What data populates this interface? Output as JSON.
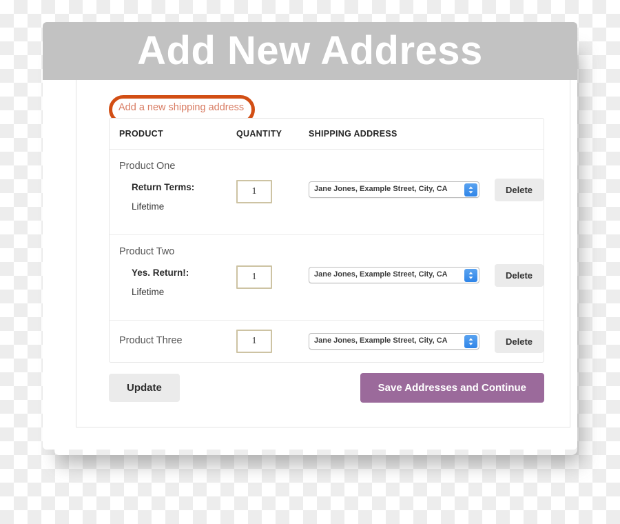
{
  "window": {
    "title": "Add New Address"
  },
  "annotation": {
    "link_label": "Add a new shipping address",
    "highlight_color": "#d24e14",
    "link_color": "#d87b62"
  },
  "table": {
    "headers": {
      "product": "PRODUCT",
      "quantity": "QUANTITY",
      "shipping_address": "SHIPPING ADDRESS"
    },
    "rows": [
      {
        "product": "Product One",
        "return_label": "Return Terms:",
        "return_value": "Lifetime",
        "quantity": "1",
        "address": "Jane Jones, Example Street, City, CA",
        "delete_label": "Delete"
      },
      {
        "product": "Product Two",
        "return_label": "Yes. Return!:",
        "return_value": "Lifetime",
        "quantity": "1",
        "address": "Jane Jones, Example Street, City, CA",
        "delete_label": "Delete"
      },
      {
        "product": "Product Three",
        "return_label": "",
        "return_value": "",
        "quantity": "1",
        "address": "Jane Jones, Example Street, City, CA",
        "delete_label": "Delete"
      }
    ]
  },
  "footer": {
    "update_label": "Update",
    "save_label": "Save Addresses and Continue",
    "save_color": "#9b6a9b"
  },
  "icons": {
    "stepper": "up-down-chevron-icon"
  }
}
